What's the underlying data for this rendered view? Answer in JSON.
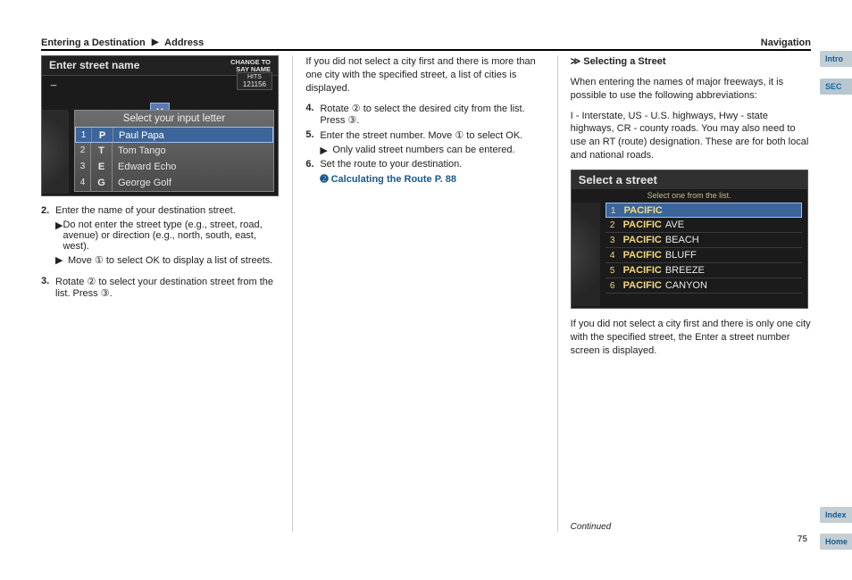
{
  "header": {
    "left": "Entering a Destination",
    "sep": "▶",
    "mid": "Address",
    "right": "Navigation"
  },
  "tabs": {
    "intro": "Intro",
    "sec": "SEC",
    "index": "Index",
    "home": "Home"
  },
  "pageNumber": "75",
  "col1": {
    "shot": {
      "title": "Enter street name",
      "change1": "CHANGE TO",
      "change2": "SAY NAME",
      "cursor": "_",
      "hitsLabel": "HITS",
      "hitsValue": "121156",
      "key": "H",
      "panelTitle": "Select your input letter",
      "rows": [
        {
          "n": "1",
          "k": "P",
          "v": "Paul Papa"
        },
        {
          "n": "2",
          "k": "T",
          "v": "Tom Tango"
        },
        {
          "n": "3",
          "k": "E",
          "v": "Edward Echo"
        },
        {
          "n": "4",
          "k": "G",
          "v": "George Golf"
        }
      ]
    },
    "step2num": "2.",
    "step2": "Enter the name of your destination street.",
    "sub1g": "▶",
    "sub1": "Do not enter the street type (e.g., street, road, avenue) or direction (e.g., north, south, east, west).",
    "sub2g": "▶",
    "sub2": "Move ① to select OK to display a list of streets.",
    "step3num": "3.",
    "step3": "Rotate ② to select your destination street from the list. Press ③."
  },
  "col2": {
    "p1": "If you did not select a city first and there is more than one city with the specified street, a list of cities is displayed.",
    "step4num": "4.",
    "step4": "Rotate ② to select the desired city from the list. Press ③.",
    "step5num": "5.",
    "step5": "Enter the street number. Move ① to select OK.",
    "sub1g": "▶",
    "sub1": "Only valid street numbers can be entered.",
    "step6num": "6.",
    "step6": "Set the route to your destination.",
    "link": "➋ Calculating the Route P. 88"
  },
  "col3": {
    "shot": {
      "title": "Select a street",
      "sub": "Select one from the list.",
      "rows": [
        {
          "n": "1",
          "m": "PACIFIC",
          "r": ""
        },
        {
          "n": "2",
          "m": "PACIFIC",
          "r": "AVE"
        },
        {
          "n": "3",
          "m": "PACIFIC",
          "r": "BEACH"
        },
        {
          "n": "4",
          "m": "PACIFIC",
          "r": "BLUFF"
        },
        {
          "n": "5",
          "m": "PACIFIC",
          "r": "BREEZE"
        },
        {
          "n": "6",
          "m": "PACIFIC",
          "r": "CANYON"
        }
      ]
    },
    "tipTitle": "≫ Selecting a Street",
    "tip1a": "When entering the names of major freeways, it is possible to use the following abbreviations:",
    "tip1b": "I - Interstate, US - U.S. highways, Hwy - state highways, CR - county roads. You may also need to use an RT (route) designation. These are for both local and national roads.",
    "tip2": "If you did not select a city first and there is only one city with the specified street, the Enter a street number screen is displayed.",
    "continued": "Continued"
  }
}
